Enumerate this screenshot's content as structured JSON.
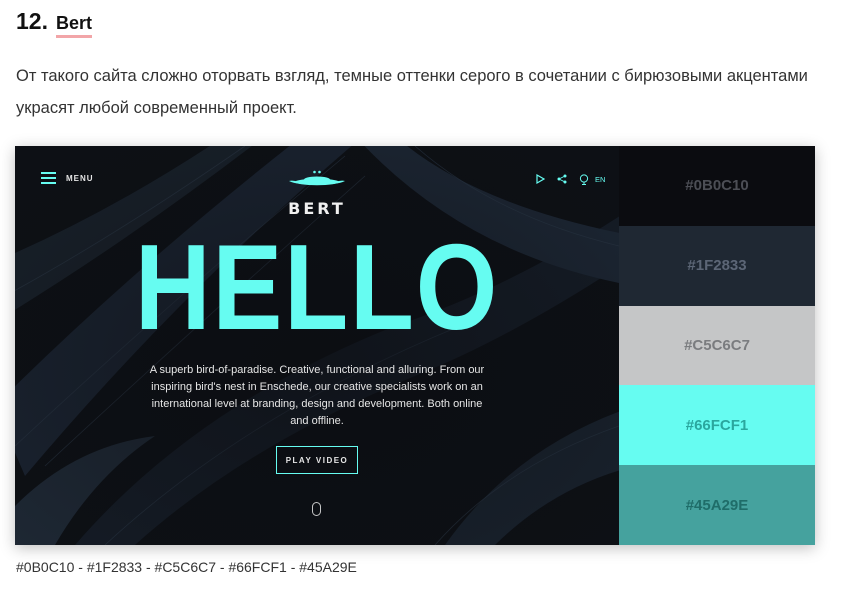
{
  "article": {
    "number": "12.",
    "title": "Bert",
    "description": "От такого сайта сложно оторвать взгляд, темные оттенки серого в сочетании с бирюзовыми акцентами украсят любой современный проект."
  },
  "site": {
    "menu_label": "MENU",
    "logo_name": "BERT",
    "lang": "EN",
    "headline": "HELLO",
    "tagline": "A superb bird-of-paradise. Creative, functional and alluring. From our inspiring bird's nest in Enschede, our creative specialists work on an international level at branding, design and development. Both online and offline.",
    "play_label": "PLAY VIDEO",
    "icons": [
      "menu-icon",
      "play-icon",
      "share-icon",
      "globe-icon",
      "mouse-scroll-icon",
      "bird-logo-icon"
    ]
  },
  "palette": [
    {
      "hex": "#0B0C10",
      "color": "#0b0c10",
      "text_color": "#4c4e55"
    },
    {
      "hex": "#1F2833",
      "color": "#1f2833",
      "text_color": "#5c6676"
    },
    {
      "hex": "#C5C6C7",
      "color": "#c5c6c7",
      "text_color": "#7a7c7f"
    },
    {
      "hex": "#66FCF1",
      "color": "#66fcf1",
      "text_color": "#2aa79e"
    },
    {
      "hex": "#45A29E",
      "color": "#45a29e",
      "text_color": "#1f6d69"
    }
  ],
  "caption": "#0B0C10 - #1F2833 - #C5C6C7 - #66FCF1 - #45A29E"
}
